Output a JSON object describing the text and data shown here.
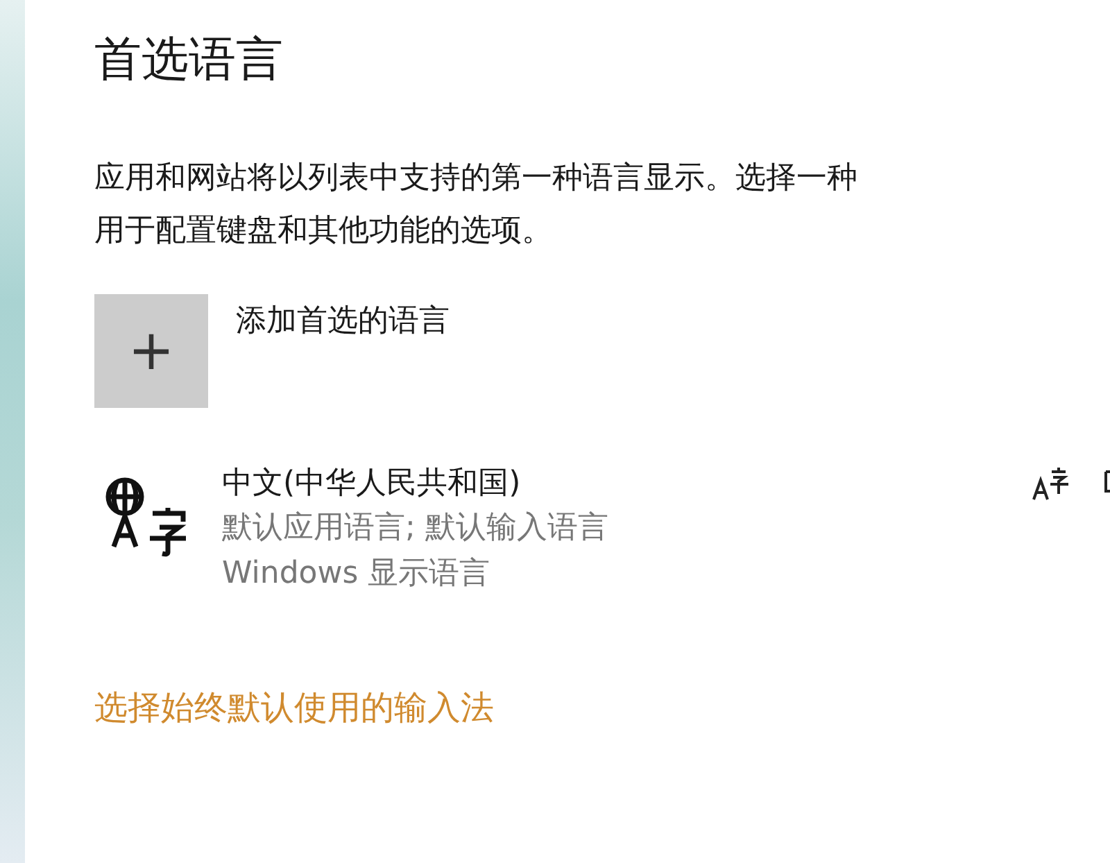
{
  "heading": "首选语言",
  "description": "应用和网站将以列表中支持的第一种语言显示。选择一种",
  "description_line_2": "用于配置键盘和其他功能的选项。",
  "add_button": {
    "icon": "+",
    "label": "添加首选的语言"
  },
  "languages": [
    {
      "name": "中文(中华人民共和国)",
      "details": [
        "默认应用语言; 默认输入语言",
        "Windows 显示语言"
      ]
    }
  ],
  "link": "选择始终默认使用的输入法"
}
